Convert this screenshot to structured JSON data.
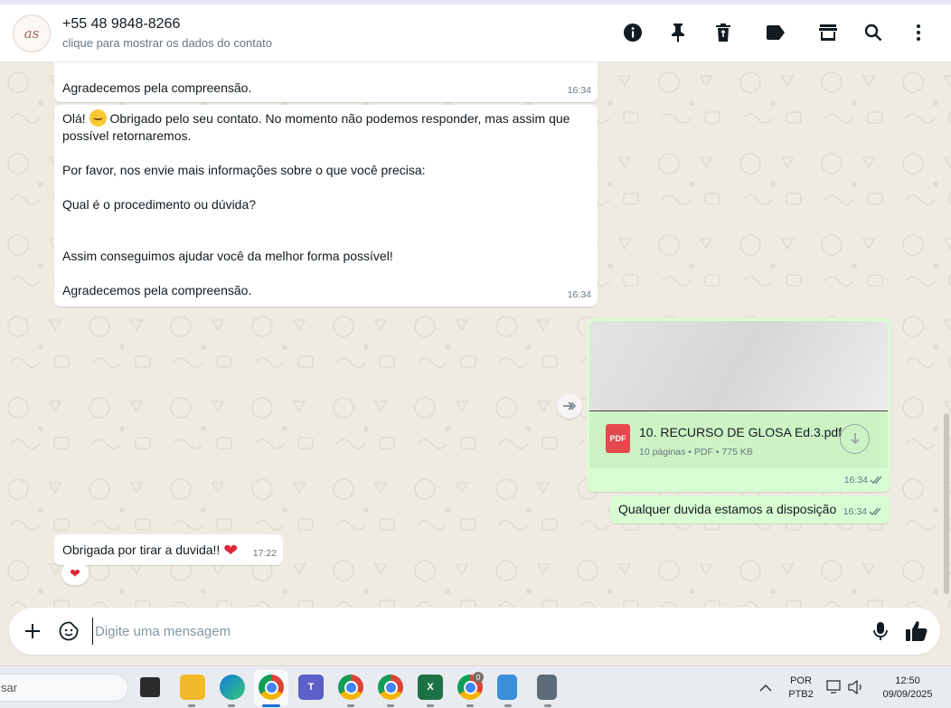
{
  "header": {
    "avatar_initials": "as",
    "contact_name": "+55 48 9848-8266",
    "contact_sub": "clique para mostrar os dados do contato",
    "icons": [
      "info-icon",
      "pin-icon",
      "trash-icon",
      "label-icon",
      "store-icon",
      "search-icon",
      "menu-icon"
    ]
  },
  "messages": [
    {
      "direction": "in",
      "text": "Agradecemos pela compreensão.",
      "time": "16:34"
    },
    {
      "direction": "in",
      "text_before_emoji": "Olá! ",
      "emoji": "smile-emoji",
      "text_after_emoji": " Obrigado pelo seu contato. No momento não podemos responder, mas assim que possível retornaremos.\n\nPor favor, nos envie mais informações sobre o que você precisa:\n\nQual é o procedimento ou dúvida?\n\n\nAssim conseguimos ajudar você da melhor forma possível!\n\nAgradecemos pela compreensão.",
      "time": "16:34"
    },
    {
      "direction": "out",
      "type": "document",
      "file_icon": "PDF",
      "file_name": "10. RECURSO DE GLOSA Ed.3.pdf",
      "file_meta": "10 páginas • PDF • 775 KB",
      "time": "16:34",
      "status": "read"
    },
    {
      "direction": "out",
      "text": "Qualquer duvida estamos a disposição",
      "time": "16:34",
      "status": "read"
    },
    {
      "direction": "in",
      "text": "Obrigada por tirar a duvida!! ",
      "emoji": "❤",
      "time": "17:22",
      "reaction": "❤"
    }
  ],
  "composer": {
    "placeholder": "Digite uma mensagem"
  },
  "taskbar": {
    "search_text": "sar",
    "lang_top": "POR",
    "lang_bottom": "PTB2",
    "clock_time": "12:50",
    "clock_date": "09/09/2025",
    "chrome_badge": "0"
  },
  "colors": {
    "incoming": "#ffffff",
    "outgoing": "#d9fdd3",
    "background": "#efeae2",
    "pdf_red": "#e5484d"
  }
}
